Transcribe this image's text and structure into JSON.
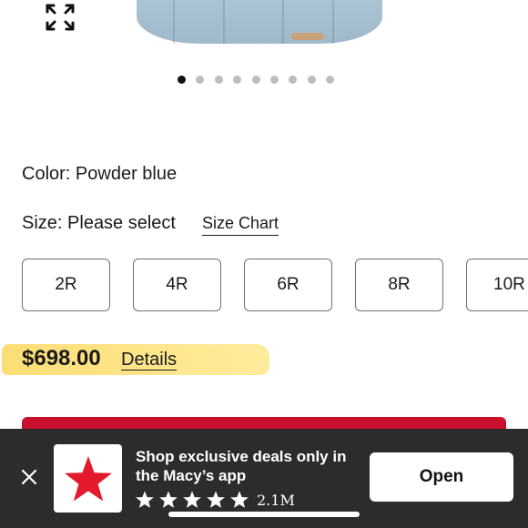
{
  "product": {
    "color_label": "Color:",
    "color_value": "Powder blue",
    "size_label": "Size:",
    "size_value": "Please select",
    "size_chart_link": "Size Chart",
    "sizes": [
      "2R",
      "4R",
      "6R",
      "8R",
      "10R"
    ],
    "price": "$698.00",
    "details_link": "Details"
  },
  "carousel": {
    "total_slides": 9,
    "active_slide": 1
  },
  "app_banner": {
    "message_line1": "Shop exclusive deals only in",
    "message_line2": "the Macy’s app",
    "rating_stars": 5,
    "rating_count": "2.1M",
    "open_label": "Open",
    "brand_color": "#e21a2c"
  },
  "icons": {
    "expand": "expand-icon",
    "close": "close-icon",
    "star": "star-icon",
    "app_logo": "macys-star-logo"
  }
}
